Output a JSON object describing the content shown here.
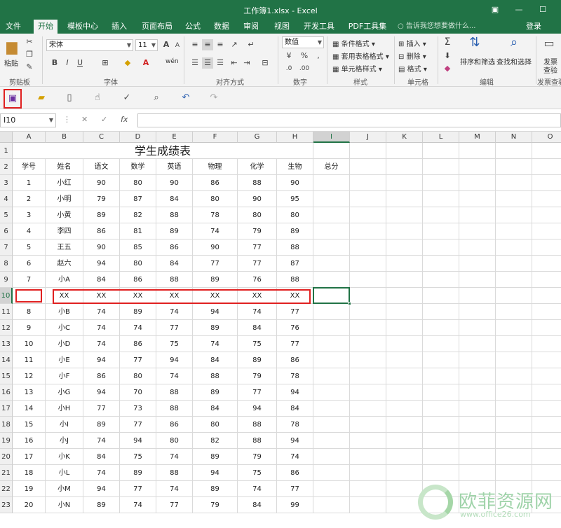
{
  "window": {
    "title": "工作簿1.xlsx - Excel",
    "controls": [
      "▣",
      "—",
      "☐"
    ]
  },
  "menu": {
    "tabs": [
      "文件",
      "开始",
      "模板中心",
      "插入",
      "页面布局",
      "公式",
      "数据",
      "审阅",
      "视图",
      "开发工具",
      "PDF工具集"
    ],
    "active_tab": "开始",
    "tell_me": "告诉我您想要做什么...",
    "login": "登录"
  },
  "ribbon": {
    "clipboard": {
      "paste": "粘贴",
      "label": "剪贴板"
    },
    "font": {
      "name": "宋体",
      "size": "11",
      "label": "字体",
      "bold": "B",
      "italic": "I",
      "underline": "U",
      "grow": "A",
      "shrink": "A",
      "wen": "wén"
    },
    "alignment": {
      "label": "对齐方式"
    },
    "number": {
      "format": "数值",
      "label": "数字",
      "percent": "%",
      "comma": ","
    },
    "styles": {
      "conditional": "条件格式",
      "table": "套用表格格式",
      "cell": "单元格样式",
      "label": "样式"
    },
    "cells": {
      "insert": "插入",
      "delete": "删除",
      "format": "格式",
      "label": "单元格"
    },
    "editing": {
      "sort": "排序和筛选",
      "find": "查找和选择",
      "label": "编辑"
    },
    "invoice": {
      "check1": "发票",
      "check2": "查验",
      "label": "发票查验"
    }
  },
  "formula_bar": {
    "name_box": "I10",
    "cancel": "✕",
    "confirm": "✓",
    "fx": "fx",
    "value": ""
  },
  "columns": [
    "A",
    "B",
    "C",
    "D",
    "E",
    "F",
    "G",
    "H",
    "I",
    "J",
    "K",
    "L",
    "M",
    "N",
    "O"
  ],
  "selected_column": "I",
  "selected_row": "10",
  "active_cell": "I10",
  "sheet": {
    "title": "学生成绩表",
    "headers": [
      "学号",
      "姓名",
      "语文",
      "数学",
      "英语",
      "物理",
      "化学",
      "生物",
      "总分"
    ],
    "rows": [
      [
        "1",
        "小红",
        "90",
        "80",
        "90",
        "86",
        "88",
        "90"
      ],
      [
        "2",
        "小明",
        "79",
        "87",
        "84",
        "80",
        "90",
        "95"
      ],
      [
        "3",
        "小黄",
        "89",
        "82",
        "88",
        "78",
        "80",
        "80"
      ],
      [
        "4",
        "李四",
        "86",
        "81",
        "89",
        "74",
        "79",
        "89"
      ],
      [
        "5",
        "王五",
        "90",
        "85",
        "86",
        "90",
        "77",
        "88"
      ],
      [
        "6",
        "赵六",
        "94",
        "80",
        "84",
        "77",
        "77",
        "87"
      ],
      [
        "7",
        "小A",
        "84",
        "86",
        "88",
        "89",
        "76",
        "88"
      ],
      [
        "",
        "XX",
        "XX",
        "XX",
        "XX",
        "XX",
        "XX",
        "XX"
      ],
      [
        "8",
        "小B",
        "74",
        "89",
        "74",
        "94",
        "74",
        "77"
      ],
      [
        "9",
        "小C",
        "74",
        "74",
        "77",
        "89",
        "84",
        "76"
      ],
      [
        "10",
        "小D",
        "74",
        "86",
        "75",
        "74",
        "75",
        "77"
      ],
      [
        "11",
        "小E",
        "94",
        "77",
        "94",
        "84",
        "89",
        "86"
      ],
      [
        "12",
        "小F",
        "86",
        "80",
        "74",
        "88",
        "79",
        "78"
      ],
      [
        "13",
        "小G",
        "94",
        "70",
        "88",
        "89",
        "77",
        "94"
      ],
      [
        "14",
        "小H",
        "77",
        "73",
        "88",
        "84",
        "94",
        "84"
      ],
      [
        "15",
        "小I",
        "89",
        "77",
        "86",
        "80",
        "88",
        "78"
      ],
      [
        "16",
        "小J",
        "74",
        "94",
        "80",
        "82",
        "88",
        "94"
      ],
      [
        "17",
        "小K",
        "84",
        "75",
        "74",
        "89",
        "79",
        "74"
      ],
      [
        "18",
        "小L",
        "74",
        "89",
        "88",
        "94",
        "75",
        "86"
      ],
      [
        "19",
        "小M",
        "94",
        "77",
        "74",
        "89",
        "74",
        "77"
      ],
      [
        "20",
        "小N",
        "89",
        "74",
        "77",
        "79",
        "84",
        "99"
      ]
    ]
  },
  "watermark": {
    "name": "欧菲资源网",
    "url": "www.office26.com"
  },
  "colors": {
    "accent": "#217346",
    "highlight": "#e02020"
  }
}
